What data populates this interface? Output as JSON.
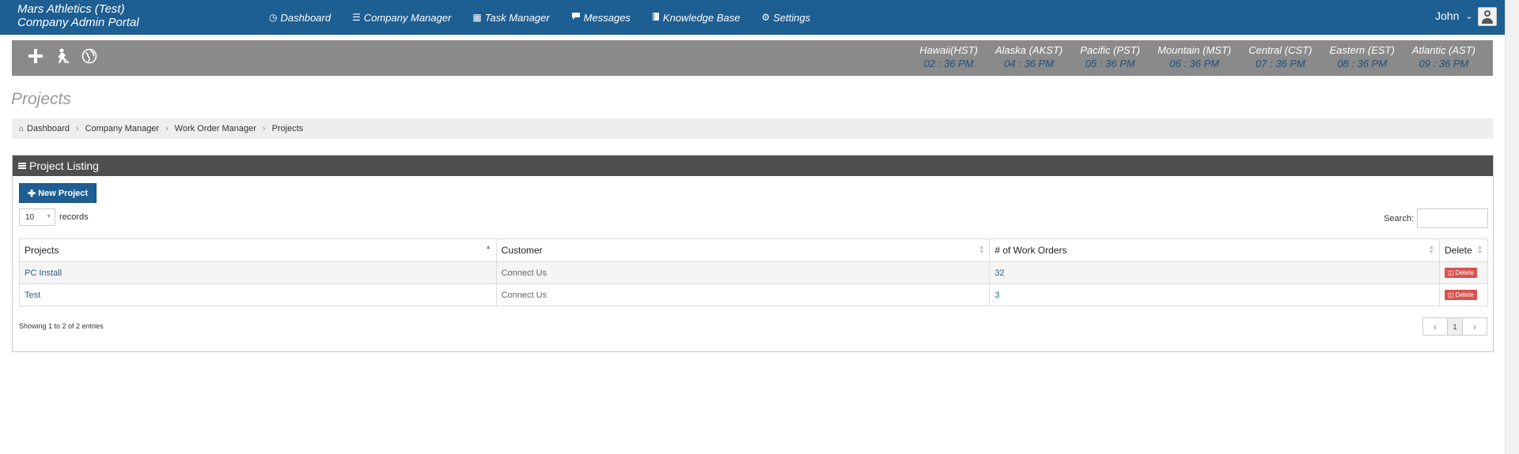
{
  "brand": {
    "line1": "Mars Athletics (Test)",
    "line2": "Company Admin Portal"
  },
  "nav": {
    "items": [
      {
        "label": "Dashboard",
        "icon": "dashboard-icon"
      },
      {
        "label": "Company Manager",
        "icon": "list-icon"
      },
      {
        "label": "Task Manager",
        "icon": "calendar-icon"
      },
      {
        "label": "Messages",
        "icon": "chat-icon"
      },
      {
        "label": "Knowledge Base",
        "icon": "book-icon"
      },
      {
        "label": "Settings",
        "icon": "gear-icon"
      }
    ],
    "user": "John"
  },
  "toolbar": {
    "icons": [
      "plus-icon",
      "worker-icon",
      "globe-icon"
    ],
    "clocks": [
      {
        "tz": "Hawaii(HST)",
        "time": "02 : 36 PM"
      },
      {
        "tz": "Alaska (AKST)",
        "time": "04 : 36 PM"
      },
      {
        "tz": "Pacific (PST)",
        "time": "05 : 36 PM"
      },
      {
        "tz": "Mountain (MST)",
        "time": "06 : 36 PM"
      },
      {
        "tz": "Central (CST)",
        "time": "07 : 36 PM"
      },
      {
        "tz": "Eastern (EST)",
        "time": "08 : 36 PM"
      },
      {
        "tz": "Atlantic (AST)",
        "time": "09 : 36 PM"
      }
    ]
  },
  "page": {
    "title": "Projects"
  },
  "breadcrumb": [
    "Dashboard",
    "Company Manager",
    "Work Order Manager",
    "Projects"
  ],
  "panel": {
    "title": "Project Listing",
    "new_button": "New Project",
    "length_value": "10",
    "length_label": "records",
    "search_label": "Search:",
    "search_value": ""
  },
  "table": {
    "columns": [
      "Projects",
      "Customer",
      "# of Work Orders",
      "Delete"
    ],
    "rows": [
      {
        "project": "PC Install",
        "customer": "Connect Us",
        "work_orders": "32",
        "delete": "Delete"
      },
      {
        "project": "Test",
        "customer": "Connect Us",
        "work_orders": "3",
        "delete": "Delete"
      }
    ],
    "info": "Showing 1 to 2 of 2 entries",
    "page": "1"
  },
  "colors": {
    "navbar": "#1d5e93",
    "toolbar": "#8a8a8a",
    "panel_header": "#4f4f4f",
    "delete": "#d9534f"
  }
}
